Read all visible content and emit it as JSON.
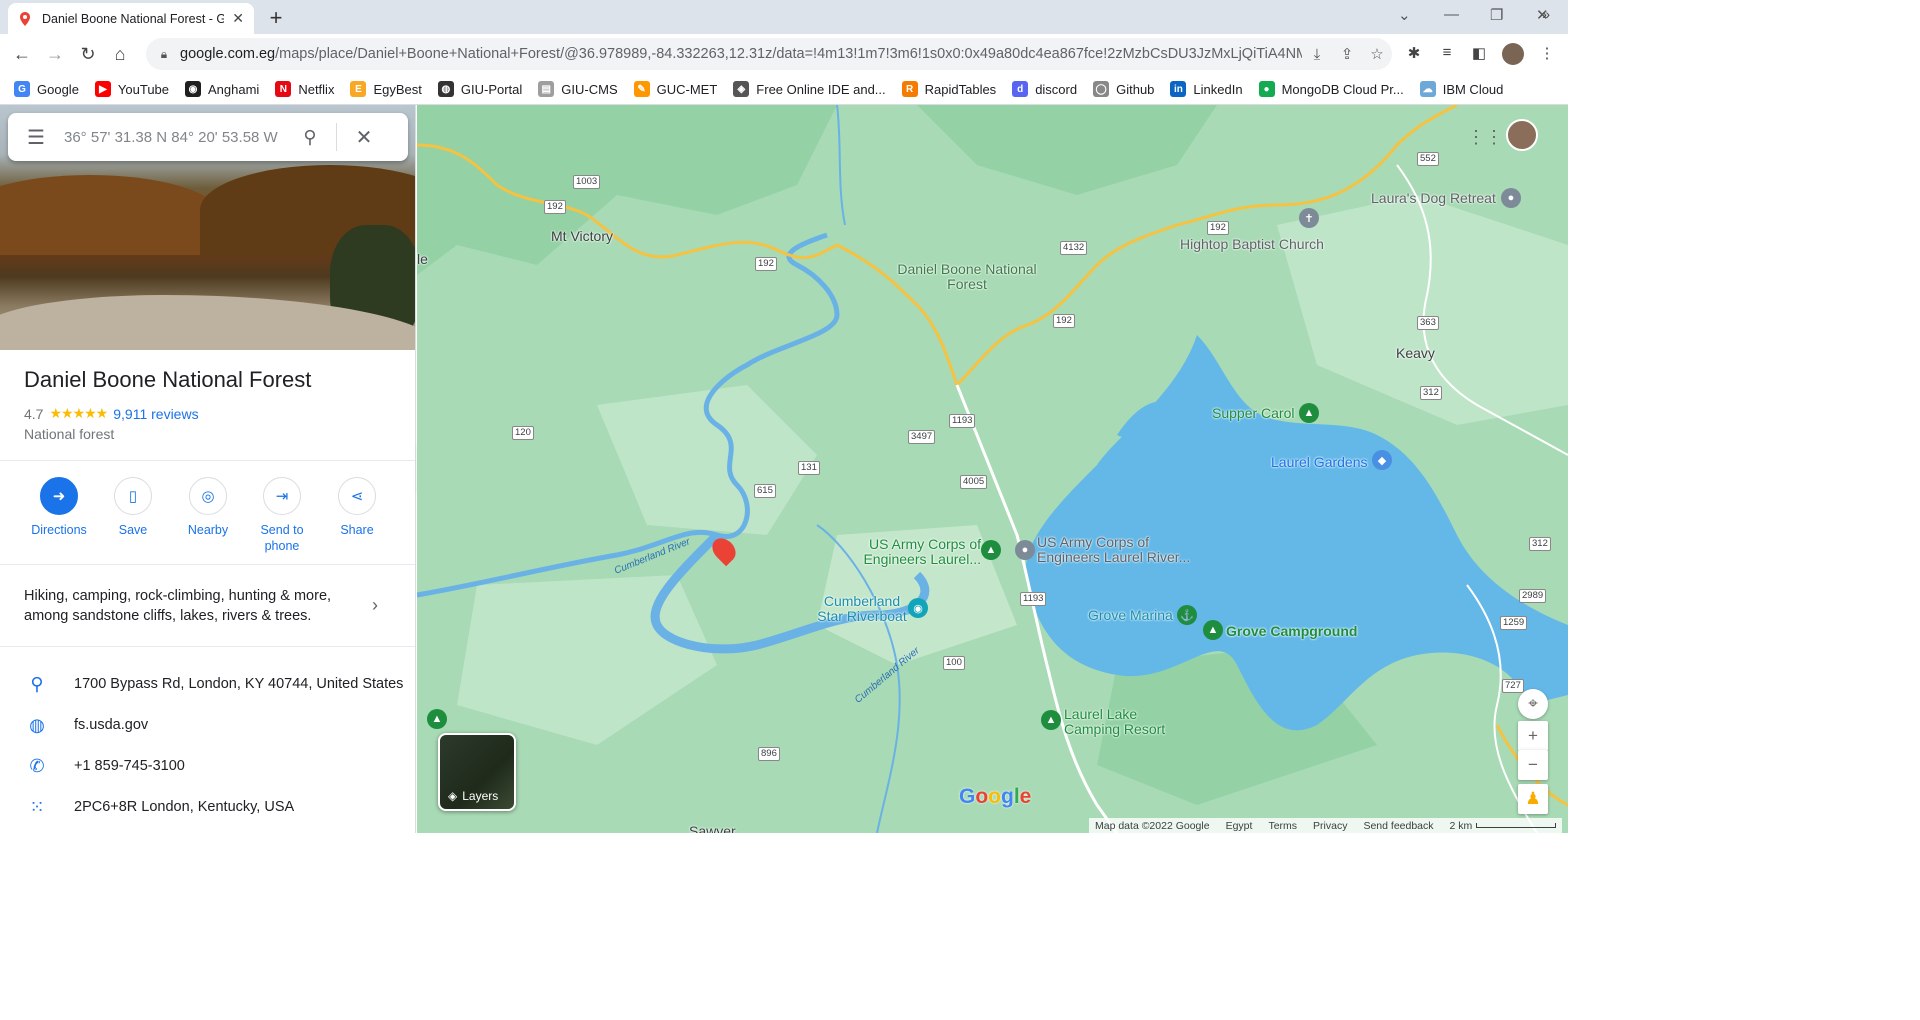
{
  "browser": {
    "tab_title": "Daniel Boone National Forest - G",
    "new_tab": "+",
    "url_domain": "google.com.eg",
    "url_path": "/maps/place/Daniel+Boone+National+Forest/@36.978989,-84.332263,12.31z/data=!4m13!1m7!3m6!1s0x0:0x49a80dc4ea867fce!2zMzbCsDU3JzMxLjQiTiA4NM..."
  },
  "bookmarks": [
    {
      "label": "Google",
      "color": "#4285f4",
      "glyph": "G"
    },
    {
      "label": "YouTube",
      "color": "#ff0000",
      "glyph": "▶"
    },
    {
      "label": "Anghami",
      "color": "#1f1f1f",
      "glyph": "◉"
    },
    {
      "label": "Netflix",
      "color": "#e50914",
      "glyph": "N"
    },
    {
      "label": "EgyBest",
      "color": "#f9a825",
      "glyph": "E"
    },
    {
      "label": "GIU-Portal",
      "color": "#333333",
      "glyph": "◍"
    },
    {
      "label": "GIU-CMS",
      "color": "#9e9e9e",
      "glyph": "▤"
    },
    {
      "label": "GUC-MET",
      "color": "#ff9800",
      "glyph": "✎"
    },
    {
      "label": "Free Online IDE and...",
      "color": "#555555",
      "glyph": "◈"
    },
    {
      "label": "RapidTables",
      "color": "#f57c00",
      "glyph": "R"
    },
    {
      "label": "discord",
      "color": "#5865f2",
      "glyph": "d"
    },
    {
      "label": "Github",
      "color": "#888888",
      "glyph": "◯"
    },
    {
      "label": "LinkedIn",
      "color": "#0a66c2",
      "glyph": "in"
    },
    {
      "label": "MongoDB Cloud Pr...",
      "color": "#13aa52",
      "glyph": "●"
    },
    {
      "label": "IBM Cloud",
      "color": "#6ea8d8",
      "glyph": "☁"
    }
  ],
  "search": {
    "placeholder": "36° 57' 31.38 N 84° 20' 53.58 W"
  },
  "place": {
    "title": "Daniel Boone National Forest",
    "rating": "4.7",
    "stars": "★★★★★",
    "reviews": "9,911 reviews",
    "category": "National forest",
    "description": "Hiking, camping, rock-climbing, hunting & more, among sandstone cliffs, lakes, rivers & trees.",
    "address": "1700 Bypass Rd, London, KY 40744, United States",
    "website": "fs.usda.gov",
    "phone": "+1 859-745-3100",
    "plus_code": "2PC6+8R London, Kentucky, USA"
  },
  "actions": {
    "directions": "Directions",
    "save": "Save",
    "nearby": "Nearby",
    "send_to_phone": "Send to phone",
    "share": "Share"
  },
  "map": {
    "labels": {
      "mt_victory": "Mt Victory",
      "dbnf": "Daniel Boone National Forest",
      "keavy": "Keavy",
      "hightop": "Hightop Baptist Church",
      "lauras": "Laura's Dog Retreat",
      "supper": "Supper Carol",
      "laurel_gardens": "Laurel Gardens",
      "usace1": "US Army Corps of Engineers Laurel...",
      "usace2": "US Army Corps of Engineers Laurel River...",
      "riverboat": "Cumberland Star Riverboat",
      "grove_marina": "Grove Marina",
      "grove_camp": "Grove Campground",
      "laurel_lake": "Laurel Lake Camping Resort",
      "cumberland_river": "Cumberland River",
      "cumberland_river2": "Cumberland River",
      "sawyer": "Sawyer",
      "le": "le"
    },
    "roads": [
      "1003",
      "192",
      "192",
      "4132",
      "192",
      "192",
      "552",
      "363",
      "312",
      "120",
      "3497",
      "1193",
      "131",
      "615",
      "4005",
      "1193",
      "100",
      "2989",
      "1259",
      "312",
      "727",
      "896"
    ],
    "layers": "Layers",
    "google_logo": "Google",
    "footer": {
      "map_data": "Map data ©2022 Google",
      "country": "Egypt",
      "terms": "Terms",
      "privacy": "Privacy",
      "feedback": "Send feedback",
      "scale": "2 km"
    }
  }
}
